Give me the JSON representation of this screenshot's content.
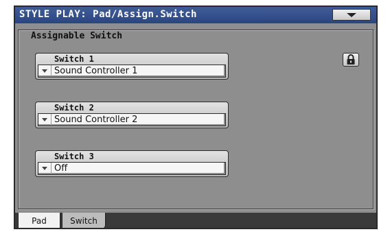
{
  "window": {
    "title": "STYLE PLAY: Pad/Assign.Switch",
    "menu_icon": "chevron-down-icon"
  },
  "group": {
    "title": "Assignable Switch"
  },
  "switches": [
    {
      "label": "Switch 1",
      "value": "Sound Controller 1"
    },
    {
      "label": "Switch 2",
      "value": "Sound Controller 2"
    },
    {
      "label": "Switch 3",
      "value": "Off"
    }
  ],
  "lock": {
    "icon": "lock-icon"
  },
  "tabs": [
    {
      "label": "Pad",
      "active": true
    },
    {
      "label": "Switch",
      "active": false
    }
  ],
  "colors": {
    "titlebar": "#2b4580",
    "panel": "#8e8e8e",
    "tabbar": "#3a3a3a"
  }
}
